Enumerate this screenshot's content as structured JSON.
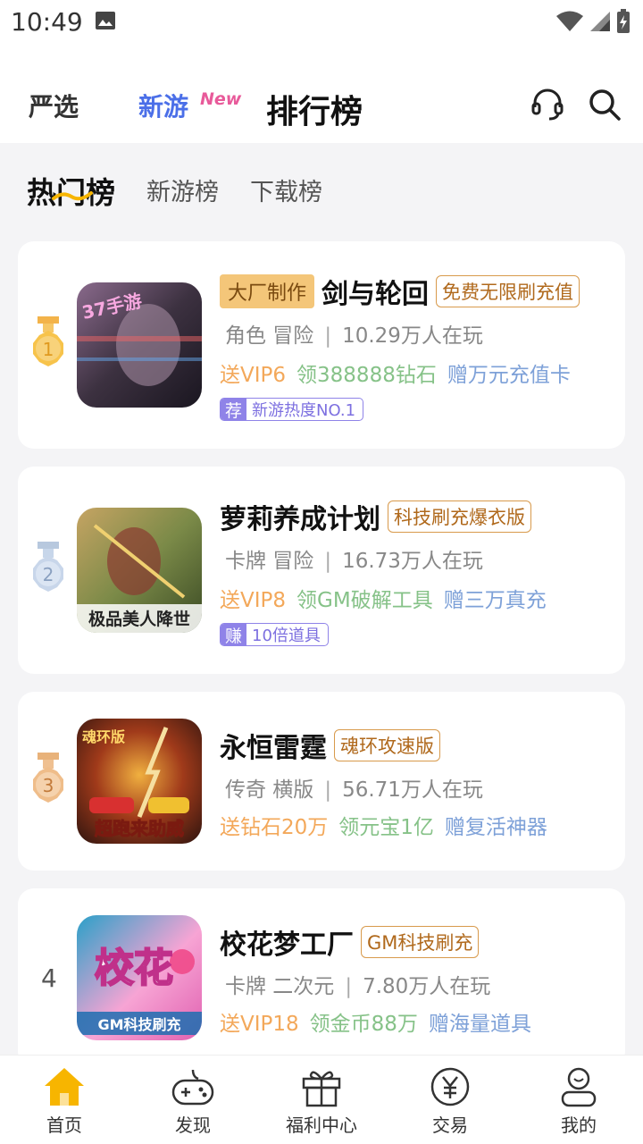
{
  "status": {
    "time": "10:49"
  },
  "topnav": {
    "yanxuan": "严选",
    "xinyou": "新游",
    "new_tag": "New",
    "ranking": "排行榜"
  },
  "subtabs": [
    "热门榜",
    "新游榜",
    "下载榜"
  ],
  "games": [
    {
      "rank": "1",
      "maker": "大厂制作",
      "name": "剑与轮回",
      "edition": "免费无限刷充值",
      "genre": "角色 冒险",
      "players": "10.29万人在玩",
      "perks": [
        "送VIP6",
        "领388888钻石",
        "赠万元充值卡"
      ],
      "tag_mark": "荐",
      "tag_text": "新游热度NO.1",
      "icon_text": "37手游",
      "icon_colors": [
        "#3c3140",
        "#6a5470",
        "#a48aa0"
      ]
    },
    {
      "rank": "2",
      "name": "萝莉养成计划",
      "edition": "科技刷充爆衣版",
      "genre": "卡牌 冒险",
      "players": "16.73万人在玩",
      "perks": [
        "送VIP8",
        "领GM破解工具",
        "赠三万真充"
      ],
      "tag_mark": "赚",
      "tag_text": "10倍道具",
      "icon_text": "极品美人降世",
      "icon_colors": [
        "#3a4a24",
        "#7b8a48",
        "#c6a463"
      ]
    },
    {
      "rank": "3",
      "name": "永恒雷霆",
      "edition": "魂环攻速版",
      "genre": "传奇 横版",
      "players": "56.71万人在玩",
      "perks": [
        "送钻石20万",
        "领元宝1亿",
        "赠复活神器"
      ],
      "icon_text": "超跑来助威",
      "icon_text_top": "魂环版",
      "icon_colors": [
        "#3a1810",
        "#a03a1a",
        "#f0b040"
      ]
    },
    {
      "rank": "4",
      "name": "校花梦工厂",
      "edition": "GM科技刷充",
      "genre": "卡牌 二次元",
      "players": "7.80万人在玩",
      "perks": [
        "送VIP18",
        "领金币88万",
        "赠海量道具"
      ],
      "icon_text": "校花",
      "icon_text_bottom": "GM科技刷充",
      "icon_colors": [
        "#2aa0c8",
        "#e060b0",
        "#f7a4d4"
      ]
    }
  ],
  "bottomnav": [
    "首页",
    "发现",
    "福利中心",
    "交易",
    "我的"
  ],
  "colors": {
    "accent": "#f7b500",
    "bg": "#f4f4f6"
  }
}
